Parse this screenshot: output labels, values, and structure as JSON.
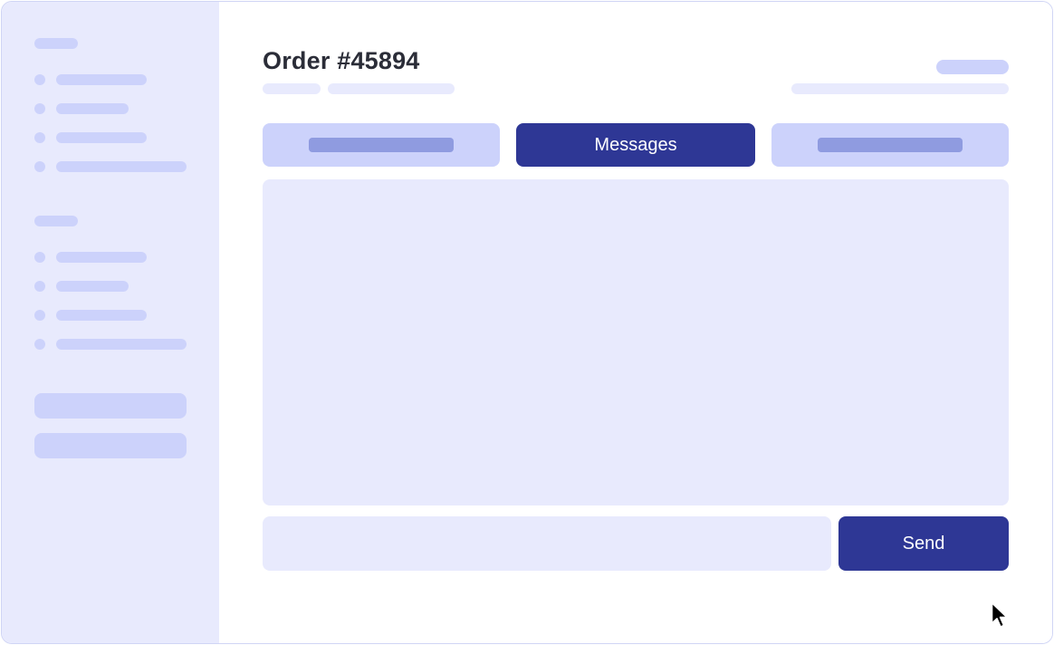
{
  "order": {
    "title": "Order #45894"
  },
  "tabs": [
    {
      "label": "",
      "active": false
    },
    {
      "label": "Messages",
      "active": true
    },
    {
      "label": "",
      "active": false
    }
  ],
  "composer": {
    "input_value": "",
    "placeholder": "",
    "send_label": "Send"
  },
  "theme": {
    "accent": "#2e3795",
    "sidebar_bg": "#e8eafd",
    "skeleton": "#ccd2fb",
    "text": "#2b2d38"
  }
}
